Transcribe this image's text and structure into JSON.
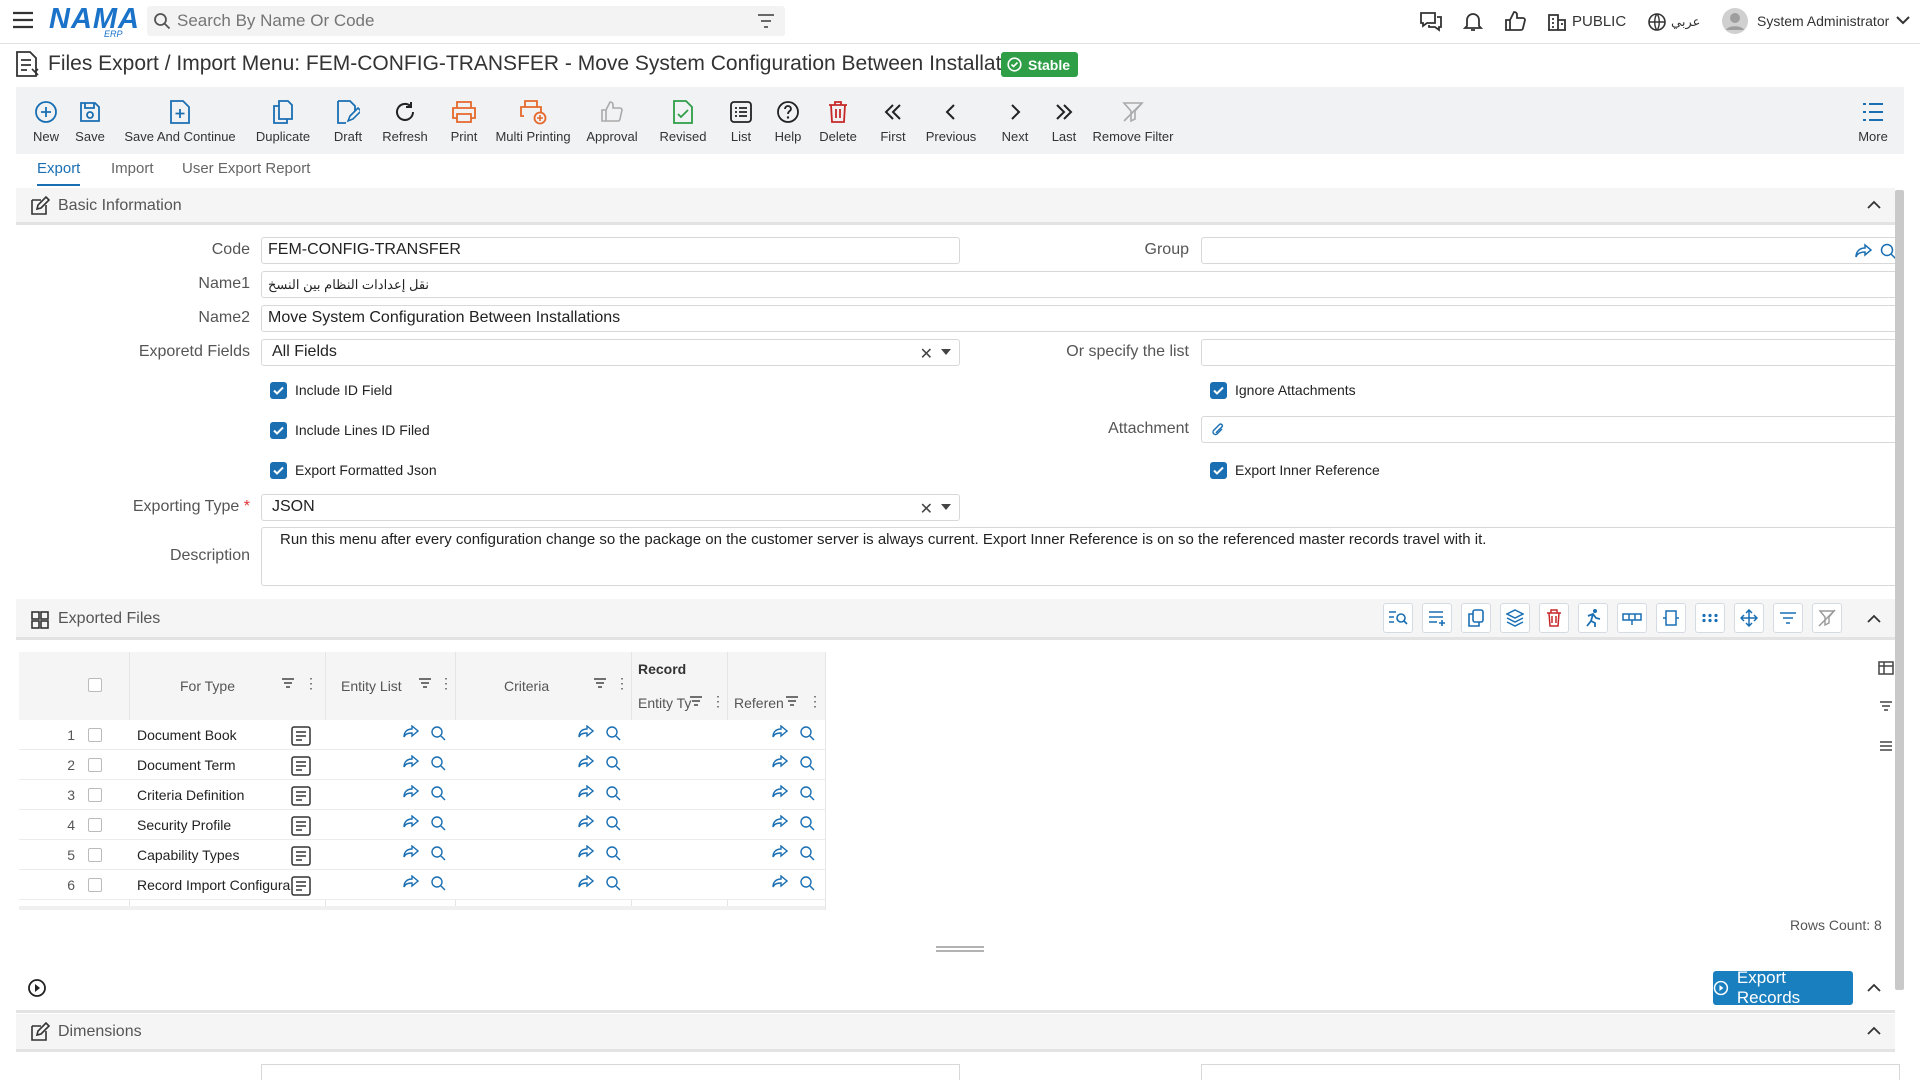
{
  "topbar": {
    "logo_text": "NAMA",
    "logo_sub": "ERP",
    "search_placeholder": "Search By Name Or Code",
    "public_label": "PUBLIC",
    "language_label": "عربي",
    "user_name": "System Administrator"
  },
  "title": {
    "text": "Files Export / Import Menu: FEM-CONFIG-TRANSFER - Move System Configuration Between Installations",
    "status": "Stable"
  },
  "toolbar": {
    "buttons": [
      {
        "label": "New",
        "icon": "plus-circle-icon"
      },
      {
        "label": "Save",
        "icon": "save-icon"
      },
      {
        "label": "Save And Continue",
        "icon": "save-continue-icon"
      },
      {
        "label": "Duplicate",
        "icon": "duplicate-icon"
      },
      {
        "label": "Draft",
        "icon": "draft-icon"
      },
      {
        "label": "Refresh",
        "icon": "refresh-icon"
      },
      {
        "label": "Print",
        "icon": "print-icon"
      },
      {
        "label": "Multi Printing",
        "icon": "multi-print-icon"
      },
      {
        "label": "Approval",
        "icon": "thumbs-up-icon"
      },
      {
        "label": "Revised",
        "icon": "revised-icon"
      },
      {
        "label": "List",
        "icon": "list-icon"
      },
      {
        "label": "Help",
        "icon": "help-icon"
      },
      {
        "label": "Delete",
        "icon": "trash-icon"
      },
      {
        "label": "First",
        "icon": "double-chevron-left-icon"
      },
      {
        "label": "Previous",
        "icon": "chevron-left-icon"
      },
      {
        "label": "Next",
        "icon": "chevron-right-icon"
      },
      {
        "label": "Last",
        "icon": "double-chevron-right-icon"
      },
      {
        "label": "Remove Filter",
        "icon": "filter-off-icon"
      },
      {
        "label": "More",
        "icon": "more-list-icon"
      }
    ]
  },
  "tabs": [
    "Export",
    "Import",
    "User Export Report"
  ],
  "basic": {
    "section_title": "Basic Information",
    "code_label": "Code",
    "code_value": "FEM-CONFIG-TRANSFER",
    "group_label": "Group",
    "group_value": "",
    "name1_label": "Name1",
    "name1_value": "نقل إعدادات النظام بين النسخ",
    "name2_label": "Name2",
    "name2_value": "Move System Configuration Between Installations",
    "exported_fields_label": "Exporetd Fields",
    "exported_fields_value": "All Fields",
    "or_specify_label": "Or specify the list",
    "or_specify_value": "",
    "include_id_field": "Include ID Field",
    "ignore_attachments": "Ignore Attachments",
    "include_lines_id": "Include Lines ID Filed",
    "attachment_label": "Attachment",
    "export_formatted_json": "Export Formatted Json",
    "export_inner_reference": "Export Inner Reference",
    "exporting_type_label": "Exporting Type",
    "required_mark": "*",
    "exporting_type_value": "JSON",
    "description_label": "Description",
    "description_value": "Run this menu after every configuration change so the package on the customer server is always current. Export Inner Reference is on so the referenced master records travel with it."
  },
  "files": {
    "section_title": "Exported Files",
    "headers": {
      "for_type": "For Type",
      "entity_list": "Entity List",
      "criteria": "Criteria",
      "record": "Record",
      "entity_type": "Entity Ty",
      "reference": "Referen"
    },
    "rows": [
      {
        "n": "1",
        "for_type": "Document Book",
        "icon": "document-book-icon"
      },
      {
        "n": "2",
        "for_type": "Document Term",
        "icon": "document-term-icon"
      },
      {
        "n": "3",
        "for_type": "Criteria Definition",
        "icon": "criteria-definition-icon"
      },
      {
        "n": "4",
        "for_type": "Security Profile",
        "icon": "security-profile-icon"
      },
      {
        "n": "5",
        "for_type": "Capability Types",
        "icon": "capability-types-icon"
      },
      {
        "n": "6",
        "for_type": "Record Import Configura",
        "icon": "record-import-icon"
      }
    ],
    "rows_count": "Rows Count: 8"
  },
  "export_button": "Export Records",
  "dimensions": {
    "section_title": "Dimensions"
  }
}
